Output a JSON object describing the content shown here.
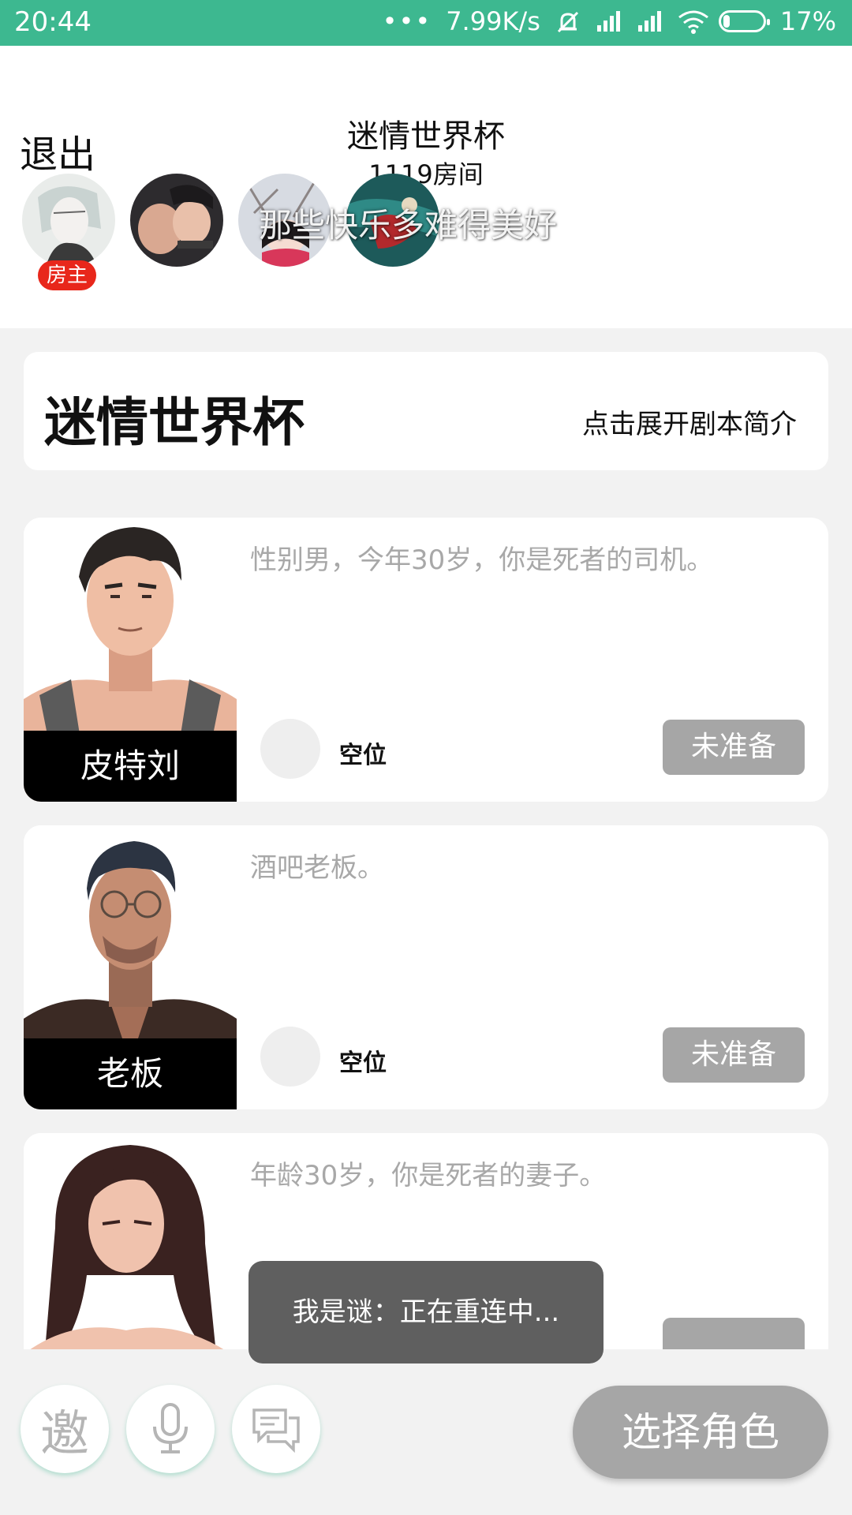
{
  "status_bar": {
    "time": "20:44",
    "dots": "•••",
    "net_speed": "7.99K/s",
    "battery": "17%",
    "battery_level": 0.17
  },
  "header": {
    "exit_label": "退出",
    "title": "迷情世界杯",
    "room_number": "1119房间",
    "host_badge": "房主",
    "danmaku": "那些快乐多难得美好"
  },
  "script_card": {
    "title": "迷情世界杯",
    "expand_label": "点击展开剧本简介"
  },
  "roles": [
    {
      "name": "皮特刘",
      "description": "性别男，今年30岁，你是死者的司机。",
      "seat": "空位",
      "status": "未准备"
    },
    {
      "name": "老板",
      "description": "酒吧老板。",
      "seat": "空位",
      "status": "未准备"
    },
    {
      "name": "",
      "description": "年龄30岁，你是死者的妻子。",
      "seat": "",
      "status": ""
    }
  ],
  "toast": "我是谜：正在重连中...",
  "bottom_bar": {
    "invite_label": "邀",
    "select_role_label": "选择角色"
  },
  "colors": {
    "accent": "#3db890",
    "host_badge": "#e8271b",
    "button_gray": "#a6a6a6"
  }
}
